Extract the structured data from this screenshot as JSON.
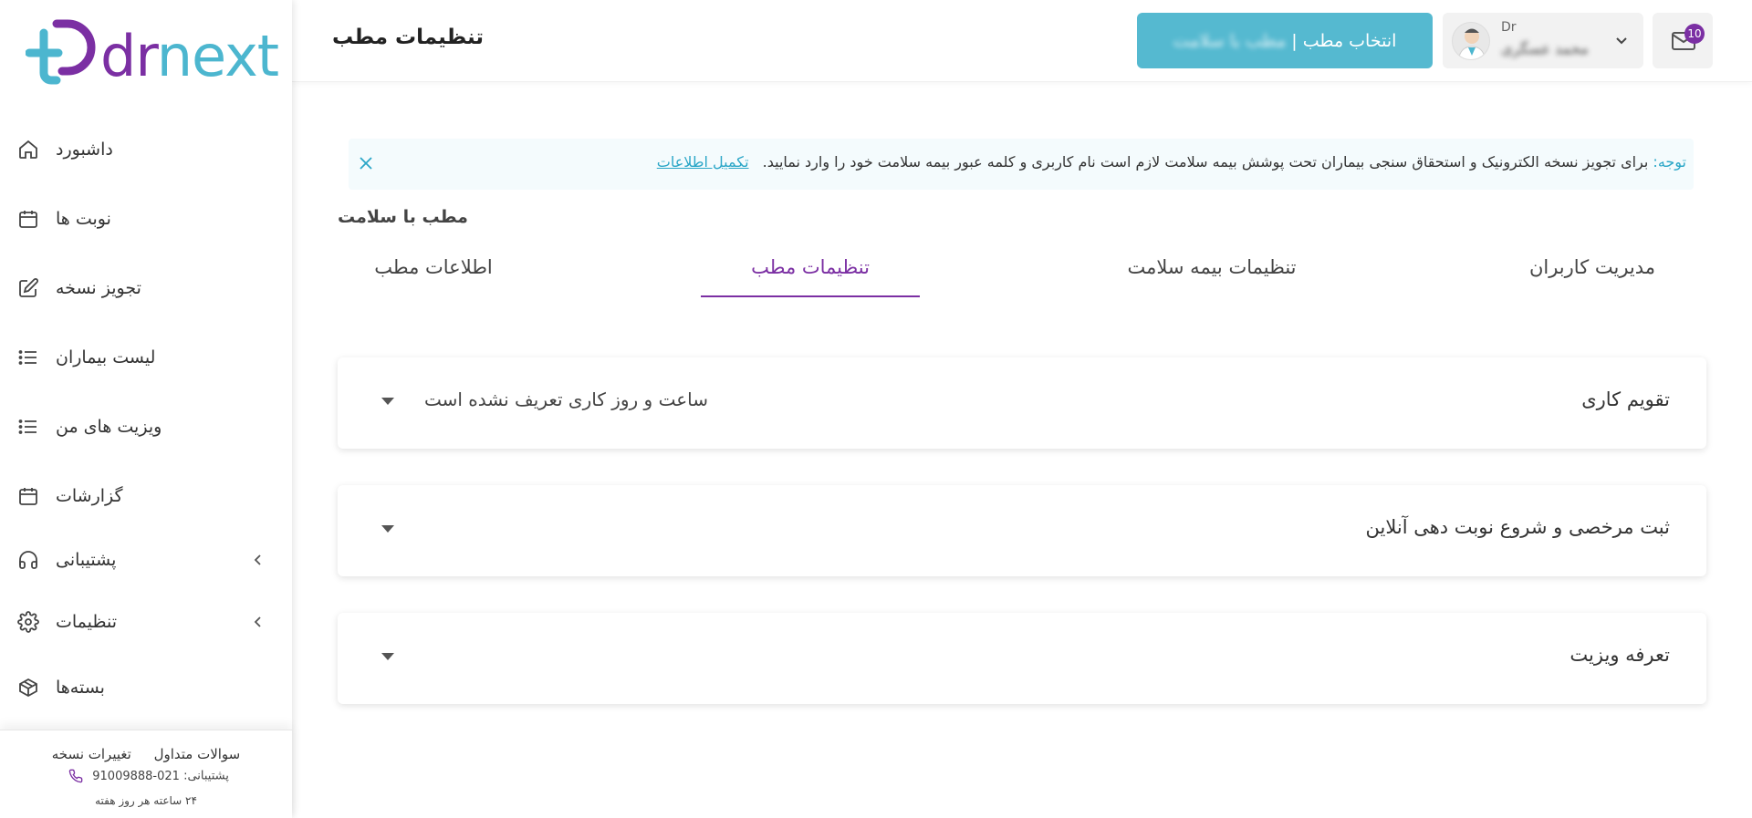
{
  "brand": {
    "logo_part1": "dr",
    "logo_part2": "next",
    "primary_color": "#7b2fa3",
    "accent_color": "#55b9d0"
  },
  "sidebar": {
    "items": [
      {
        "label": "داشبورد",
        "icon": "home-icon"
      },
      {
        "label": "نوبت ها",
        "icon": "calendar-icon"
      },
      {
        "label": "تجویز نسخه",
        "icon": "edit-icon"
      },
      {
        "label": "لیست بیماران",
        "icon": "list-icon"
      },
      {
        "label": "ویزیت های من",
        "icon": "list-icon"
      },
      {
        "label": "گزارشات",
        "icon": "calendar-icon"
      },
      {
        "label": "پشتیبانی",
        "icon": "headphones-icon"
      },
      {
        "label": "تنظیمات",
        "icon": "gear-icon"
      },
      {
        "label": "بسته‌ها",
        "icon": "package-icon"
      }
    ],
    "footer": {
      "faq": "سوالات متداول",
      "changelog": "تغییرات نسخه",
      "phone_label": "پشتیبانی:",
      "phone": "021-91009888",
      "hours": "۲۴ ساعته هر روز هفته"
    }
  },
  "header": {
    "page_title": "تنظیمات مطب",
    "office_button": "انتخاب مطب |",
    "office_button_selected": "مطب با سلامت",
    "profile_prefix": "Dr",
    "profile_name": "محمد عسگری",
    "notifications_count": "10"
  },
  "notice": {
    "prefix": "توجه:",
    "message": "برای تجویز نسخه الکترونیک و استحقاق سنجی بیماران تحت پوشش بیمه سلامت لازم است نام کاربری و کلمه عبور بیمه سلامت خود را وارد نمایید.",
    "link": "تکمیل اطلاعات"
  },
  "office_name": "مطب با سلامت",
  "tabs": [
    {
      "label": "مدیریت کاربران",
      "active": false
    },
    {
      "label": "تنظیمات بیمه سلامت",
      "active": false
    },
    {
      "label": "تنظیمات مطب",
      "active": true
    },
    {
      "label": "اطلاعات مطب",
      "active": false
    }
  ],
  "panels": [
    {
      "title": "تقویم کاری",
      "subtitle": "ساعت و روز کاری تعریف نشده است"
    },
    {
      "title": "ثبت مرخصی و شروع نوبت دهی آنلاین",
      "subtitle": ""
    },
    {
      "title": "تعرفه ویزیت",
      "subtitle": ""
    }
  ]
}
